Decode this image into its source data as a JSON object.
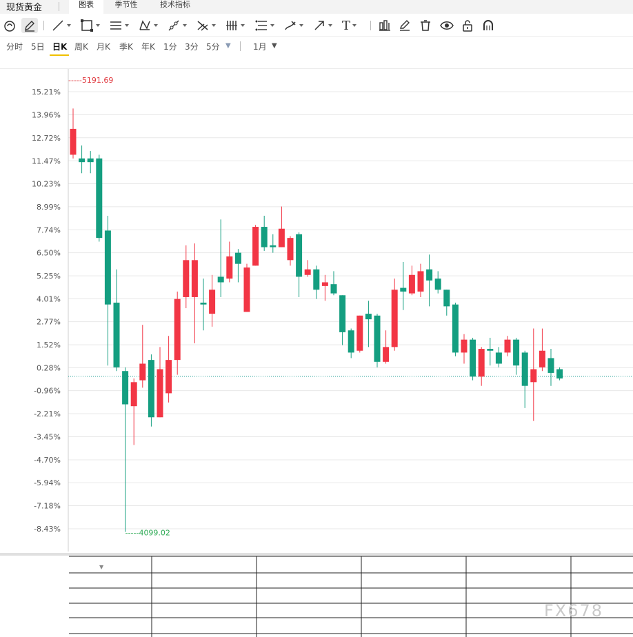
{
  "header": {
    "title": "现货黄金",
    "tabs": [
      {
        "label": "图表",
        "active": true
      },
      {
        "label": "季节性",
        "active": false
      },
      {
        "label": "技术指标",
        "active": false
      }
    ]
  },
  "toolbar": {
    "tools": [
      "magnet-icon",
      "pencil-icon",
      "line-icon",
      "rectangle-icon",
      "parallel-lines-icon",
      "pattern-icon",
      "ray-icon",
      "fork-icon",
      "vertical-lines-icon",
      "fib-icon",
      "brush-icon",
      "arrow-icon",
      "text-icon",
      "bar-style-icon",
      "edit-icon",
      "trash-icon",
      "eye-icon",
      "unlock-icon",
      "magnet-u-icon"
    ],
    "text_tool_glyph": "T"
  },
  "periods": {
    "items": [
      {
        "label": "分时",
        "active": false
      },
      {
        "label": "5日",
        "active": false
      },
      {
        "label": "日K",
        "active": true
      },
      {
        "label": "周K",
        "active": false
      },
      {
        "label": "月K",
        "active": false
      },
      {
        "label": "季K",
        "active": false
      },
      {
        "label": "年K",
        "active": false
      },
      {
        "label": "1分",
        "active": false
      },
      {
        "label": "3分",
        "active": false
      },
      {
        "label": "5分",
        "active": false
      }
    ],
    "more_glyph": "▼",
    "range_label": "1月",
    "range_glyph": "▼"
  },
  "colors": {
    "up": "#f23645",
    "down": "#149e80",
    "max_label": "#e0383e",
    "min_label": "#2eaa55",
    "grid": "#e8e8e8",
    "axis_text": "#555555",
    "baseline": "#2aa198"
  },
  "chart_data": {
    "type": "candlestick",
    "y_axis": {
      "unit": "%",
      "tick_labels": [
        "15.21%",
        "13.96%",
        "12.72%",
        "11.47%",
        "10.23%",
        "8.99%",
        "7.74%",
        "6.50%",
        "5.25%",
        "4.01%",
        "2.77%",
        "1.52%",
        "0.28%",
        "-0.96%",
        "-2.21%",
        "-3.45%",
        "-4.70%",
        "-5.94%",
        "-7.18%",
        "-8.43%"
      ],
      "range": [
        -8.43,
        15.21
      ]
    },
    "max_label": "5191.69",
    "min_label": "4099.02",
    "baseline_pct": -0.19,
    "candles": [
      {
        "o": 11.8,
        "c": 13.2,
        "h": 14.3,
        "l": 11.6
      },
      {
        "o": 11.6,
        "c": 11.4,
        "h": 12.3,
        "l": 10.8
      },
      {
        "o": 11.6,
        "c": 11.4,
        "h": 12.0,
        "l": 10.8
      },
      {
        "o": 11.6,
        "c": 7.3,
        "h": 11.8,
        "l": 7.1
      },
      {
        "o": 7.7,
        "c": 3.7,
        "h": 8.5,
        "l": 0.4
      },
      {
        "o": 3.8,
        "c": 0.3,
        "h": 5.6,
        "l": 0.1
      },
      {
        "o": 0.1,
        "c": -1.7,
        "h": 0.3,
        "l": -8.6
      },
      {
        "o": -1.8,
        "c": -0.5,
        "h": -0.3,
        "l": -3.9
      },
      {
        "o": -0.4,
        "c": 0.5,
        "h": 2.6,
        "l": -0.8
      },
      {
        "o": 0.7,
        "c": -2.4,
        "h": 1.0,
        "l": -2.9
      },
      {
        "o": -2.4,
        "c": 0.2,
        "h": 1.4,
        "l": -2.4
      },
      {
        "o": -1.1,
        "c": 0.7,
        "h": 2.0,
        "l": -1.6
      },
      {
        "o": 0.7,
        "c": 4.0,
        "h": 4.4,
        "l": -0.1
      },
      {
        "o": 4.1,
        "c": 6.1,
        "h": 6.9,
        "l": 3.5
      },
      {
        "o": 4.1,
        "c": 6.1,
        "h": 7.0,
        "l": 1.6
      },
      {
        "o": 3.8,
        "c": 3.7,
        "h": 5.1,
        "l": 2.3
      },
      {
        "o": 3.2,
        "c": 4.5,
        "h": 5.3,
        "l": 2.5
      },
      {
        "o": 5.2,
        "c": 4.9,
        "h": 8.3,
        "l": 4.1
      },
      {
        "o": 5.1,
        "c": 6.3,
        "h": 7.1,
        "l": 4.9
      },
      {
        "o": 6.5,
        "c": 5.9,
        "h": 6.7,
        "l": 4.9
      },
      {
        "o": 3.3,
        "c": 5.7,
        "h": 5.9,
        "l": 3.3
      },
      {
        "o": 5.8,
        "c": 7.9,
        "h": 8.0,
        "l": 5.8
      },
      {
        "o": 7.9,
        "c": 6.8,
        "h": 8.5,
        "l": 6.6
      },
      {
        "o": 6.9,
        "c": 6.8,
        "h": 7.5,
        "l": 6.5
      },
      {
        "o": 6.8,
        "c": 7.8,
        "h": 9.0,
        "l": 6.8
      },
      {
        "o": 6.1,
        "c": 7.3,
        "h": 7.4,
        "l": 5.8
      },
      {
        "o": 7.5,
        "c": 5.2,
        "h": 7.6,
        "l": 4.1
      },
      {
        "o": 5.3,
        "c": 5.6,
        "h": 6.1,
        "l": 5.2
      },
      {
        "o": 5.6,
        "c": 4.5,
        "h": 5.8,
        "l": 4.0
      },
      {
        "o": 4.7,
        "c": 4.9,
        "h": 5.3,
        "l": 3.9
      },
      {
        "o": 4.8,
        "c": 4.3,
        "h": 5.5,
        "l": 4.2
      },
      {
        "o": 4.2,
        "c": 2.2,
        "h": 4.2,
        "l": 1.5
      },
      {
        "o": 2.3,
        "c": 1.1,
        "h": 2.4,
        "l": 0.8
      },
      {
        "o": 1.2,
        "c": 3.1,
        "h": 3.1,
        "l": 1.1
      },
      {
        "o": 3.2,
        "c": 2.9,
        "h": 3.9,
        "l": 1.4
      },
      {
        "o": 3.1,
        "c": 0.6,
        "h": 3.2,
        "l": 0.3
      },
      {
        "o": 0.6,
        "c": 1.4,
        "h": 2.3,
        "l": 0.5
      },
      {
        "o": 1.4,
        "c": 4.5,
        "h": 5.1,
        "l": 1.2
      },
      {
        "o": 4.6,
        "c": 4.4,
        "h": 6.0,
        "l": 3.4
      },
      {
        "o": 4.3,
        "c": 5.3,
        "h": 5.8,
        "l": 4.2
      },
      {
        "o": 4.4,
        "c": 5.5,
        "h": 5.9,
        "l": 4.1
      },
      {
        "o": 5.6,
        "c": 5.0,
        "h": 6.4,
        "l": 3.6
      },
      {
        "o": 5.1,
        "c": 4.5,
        "h": 5.5,
        "l": 4.3
      },
      {
        "o": 4.5,
        "c": 3.6,
        "h": 4.5,
        "l": 3.1
      },
      {
        "o": 3.7,
        "c": 1.1,
        "h": 3.8,
        "l": 0.9
      },
      {
        "o": 1.1,
        "c": 1.8,
        "h": 2.1,
        "l": 0.5
      },
      {
        "o": 1.8,
        "c": -0.2,
        "h": 1.9,
        "l": -0.4
      },
      {
        "o": -0.2,
        "c": 1.3,
        "h": 1.4,
        "l": -0.7
      },
      {
        "o": 1.3,
        "c": 1.2,
        "h": 1.9,
        "l": 0.4
      },
      {
        "o": 1.1,
        "c": 0.5,
        "h": 1.4,
        "l": 0.3
      },
      {
        "o": 1.1,
        "c": 1.8,
        "h": 2.0,
        "l": 0.9
      },
      {
        "o": 1.8,
        "c": 0.4,
        "h": 1.9,
        "l": -0.1
      },
      {
        "o": 1.1,
        "c": -0.7,
        "h": 1.2,
        "l": -1.9
      },
      {
        "o": -0.5,
        "c": 0.2,
        "h": 2.4,
        "l": -2.6
      },
      {
        "o": 0.3,
        "c": 1.2,
        "h": 2.4,
        "l": 0.1
      },
      {
        "o": 0.8,
        "c": 0.0,
        "h": 1.3,
        "l": -0.7
      },
      {
        "o": 0.2,
        "c": -0.3,
        "h": 0.3,
        "l": -0.4
      }
    ]
  },
  "bottom_table": {
    "columns": [
      "",
      "",
      "",
      "",
      "",
      ""
    ],
    "dropdown_glyph": "▼",
    "rows": 4
  },
  "watermark": "FX678"
}
